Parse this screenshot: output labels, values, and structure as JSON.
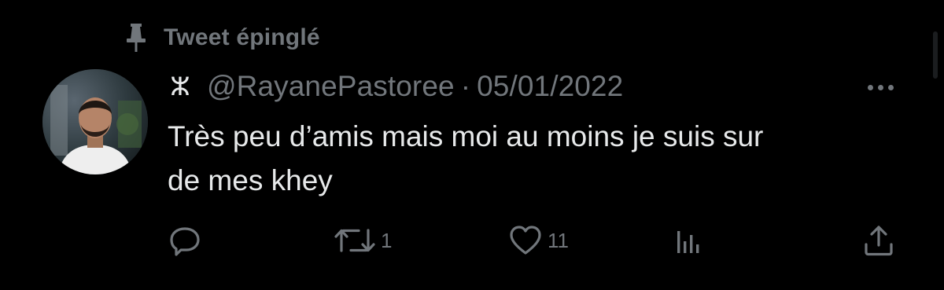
{
  "pinned": {
    "label": "Tweet épinglé",
    "icon": "pin-icon"
  },
  "author": {
    "name_glyph": "ⵣ",
    "handle": "@RayanePastoree",
    "separator": "·",
    "date": "05/01/2022",
    "avatar_icon": "avatar-photo"
  },
  "tweet": {
    "text": "Très peu d’amis mais moi au moins je suis sur\nde mes khey"
  },
  "actions": {
    "reply": {
      "icon": "reply-icon",
      "count": ""
    },
    "retweet": {
      "icon": "retweet-icon",
      "count": "1"
    },
    "like": {
      "icon": "heart-icon",
      "count": "11"
    },
    "views": {
      "icon": "views-icon",
      "count": ""
    },
    "share": {
      "icon": "share-icon",
      "count": ""
    }
  },
  "colors": {
    "background": "#000000",
    "primary_text": "#e7e9ea",
    "secondary_text": "#71767b"
  }
}
